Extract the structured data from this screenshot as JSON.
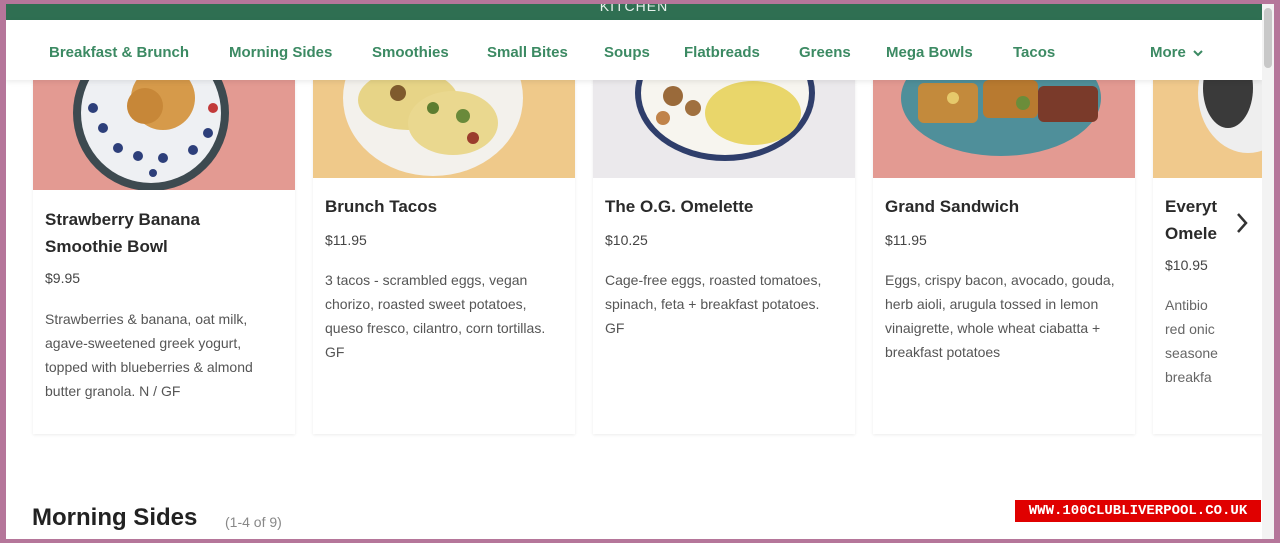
{
  "brand": {
    "title": "KITCHEN"
  },
  "nav": {
    "items": [
      "Breakfast & Brunch",
      "Morning Sides",
      "Smoothies",
      "Small Bites",
      "Soups",
      "Flatbreads",
      "Greens",
      "Mega Bowls",
      "Tacos"
    ],
    "more_label": "More"
  },
  "menu": {
    "cards": [
      {
        "name": "Strawberry Banana Smoothie Bowl",
        "price": "$9.95",
        "description": "Strawberries & banana, oat milk, agave-sweetened greek yogurt, topped with blueberries & almond butter granola. N / GF"
      },
      {
        "name": "Brunch Tacos",
        "price": "$11.95",
        "description": "3 tacos - scrambled eggs, vegan chorizo, roasted sweet potatoes, queso fresco, cilantro, corn tortillas. GF"
      },
      {
        "name": "The O.G. Omelette",
        "price": "$10.25",
        "description": "Cage-free eggs, roasted tomatoes, spinach, feta + breakfast potatoes. GF"
      },
      {
        "name": "Grand Sandwich",
        "price": "$11.95",
        "description": "Eggs, crispy bacon, avocado, gouda, herb aioli, arugula tossed in lemon vinaigrette, whole wheat ciabatta + breakfast potatoes"
      },
      {
        "name": "Everyt Omele",
        "price": "$10.95",
        "description": "Antibio red onic seasone breakfa"
      }
    ]
  },
  "section": {
    "title": "Morning Sides",
    "count": "(1-4 of 9)"
  },
  "watermark": {
    "text": "WWW.100CLUBLIVERPOOL.CO.UK"
  },
  "colors": {
    "brand_green": "#2f6f52",
    "nav_text": "#3c8a63",
    "frame": "#b5769a"
  }
}
